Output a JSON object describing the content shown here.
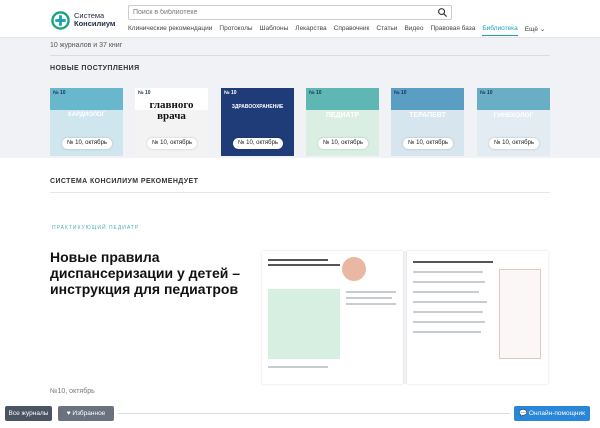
{
  "header": {
    "logo_line1": "Система",
    "logo_line2": "Консилиум",
    "search_placeholder": "Поиск в библиотеке",
    "nav": [
      {
        "label": "Клинические рекомендации",
        "active": false
      },
      {
        "label": "Протоколы",
        "active": false
      },
      {
        "label": "Шаблоны",
        "active": false
      },
      {
        "label": "Лекарства",
        "active": false
      },
      {
        "label": "Справочник",
        "active": false
      },
      {
        "label": "Статьи",
        "active": false
      },
      {
        "label": "Видео",
        "active": false
      },
      {
        "label": "Правовая база",
        "active": false
      },
      {
        "label": "Библиотека",
        "active": true
      },
      {
        "label": "Ещё ⌄",
        "active": false
      }
    ]
  },
  "library": {
    "counts": "10 журналов и 37 книг",
    "new_title": "НОВЫЕ ПОСТУПЛЕНИЯ",
    "covers": [
      {
        "num": "№ 10",
        "title": "КАРДИОЛОГ",
        "badge": "№ 10, октябрь",
        "color": "#cfe6ee",
        "head": "#68b7cc"
      },
      {
        "num": "№ 10",
        "title": "главного врача",
        "badge": "№ 10, октябрь",
        "color": "#f3f3f3",
        "head": "#ffffff"
      },
      {
        "num": "№ 10",
        "title": "ЗДРАВООХРАНЕНИЕ",
        "badge": "№ 10, октябрь",
        "color": "#1f3c78",
        "head": "#1f3c78"
      },
      {
        "num": "№ 10",
        "title": "ПЕДИАТР",
        "badge": "№ 10, октябрь",
        "color": "#dbeee4",
        "head": "#5fb7b4"
      },
      {
        "num": "№ 10",
        "title": "ТЕРАПЕВТ",
        "badge": "№ 10, октябрь",
        "color": "#d7e5ee",
        "head": "#5a9ec4"
      },
      {
        "num": "№ 10",
        "title": "ГИНЕКОЛОГ",
        "badge": "№ 10, октябрь",
        "color": "#e3ecf2",
        "head": "#6aaec6"
      }
    ],
    "recommends_title": "СИСТЕМА КОНСИЛИУМ РЕКОМЕНДУЕТ"
  },
  "feature": {
    "brand": "ПРАКТИКУЮЩИЙ ПЕДИАТР",
    "title": "Новые правила диспансеризации у детей – инструкция для педиатров",
    "issue": "№10, октябрь"
  },
  "bottom": {
    "all_journals": "Все журналы",
    "favorites": "♥ Избранное",
    "help": "💬 Онлайн-помощник"
  }
}
